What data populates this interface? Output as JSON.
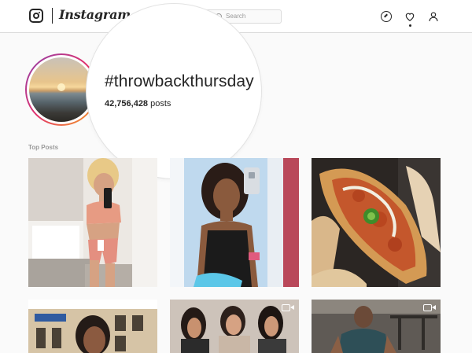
{
  "header": {
    "logo_icon": "instagram-glyph-icon",
    "wordmark": "Instagram",
    "search_placeholder": "Search",
    "icons": [
      "compass-icon",
      "heart-icon",
      "person-icon"
    ]
  },
  "profile": {
    "hashtag": "#throwbackthursday",
    "post_count": "42,756,428",
    "post_label": "posts"
  },
  "sections": {
    "top_posts_label": "Top Posts"
  },
  "grid": {
    "tiles": [
      {
        "name": "woman in pink workout outfit taking mirror selfie",
        "video": false
      },
      {
        "name": "woman in black tank top taking mirror selfie",
        "video": false
      },
      {
        "name": "sandwich with jalapeno and sauce",
        "video": false
      },
      {
        "name": "woman in front of building facade",
        "video": false
      },
      {
        "name": "three women posing together",
        "video": true
      },
      {
        "name": "man in gym",
        "video": true
      }
    ]
  },
  "colors": {
    "ring_gradient": [
      "#8e44ad",
      "#e1306c",
      "#f5a623"
    ],
    "text": "#262626",
    "muted": "#999999"
  }
}
